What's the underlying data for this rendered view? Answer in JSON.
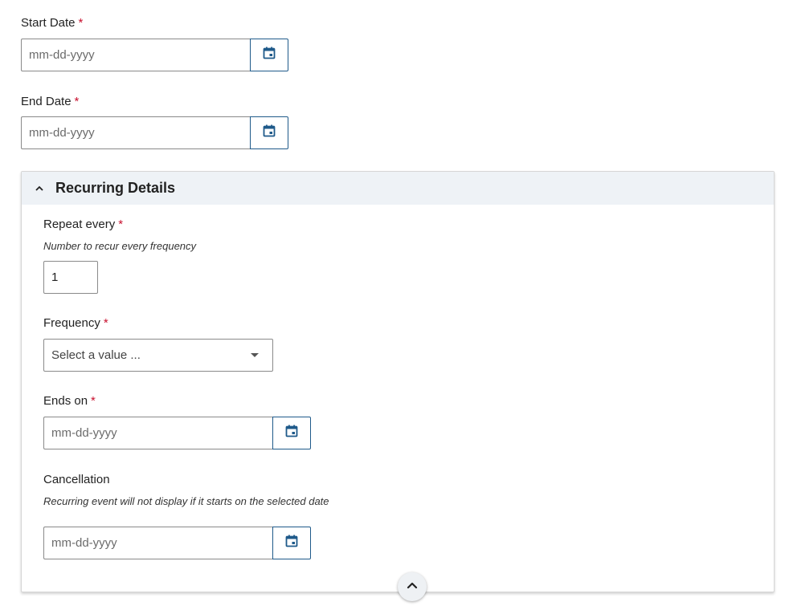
{
  "start_date": {
    "label": "Start Date",
    "required_mark": "*",
    "placeholder": "mm-dd-yyyy",
    "value": "",
    "icon": "calendar-icon"
  },
  "end_date": {
    "label": "End Date",
    "required_mark": "*",
    "placeholder": "mm-dd-yyyy",
    "value": "",
    "icon": "calendar-icon"
  },
  "recurring": {
    "title": "Recurring Details",
    "expanded": true,
    "repeat_every": {
      "label": "Repeat every",
      "required_mark": "*",
      "hint": "Number to recur every frequency",
      "value": "1"
    },
    "frequency": {
      "label": "Frequency",
      "required_mark": "*",
      "selected": "Select a value ..."
    },
    "ends_on": {
      "label": "Ends on",
      "required_mark": "*",
      "placeholder": "mm-dd-yyyy",
      "value": ""
    },
    "cancellation": {
      "label": "Cancellation",
      "hint": "Recurring event will not display if it starts on the selected date",
      "placeholder": "mm-dd-yyyy",
      "value": ""
    }
  },
  "colors": {
    "accent": "#1f5a8a",
    "required": "#c8102e",
    "panel_header_bg": "#eef2f6"
  }
}
